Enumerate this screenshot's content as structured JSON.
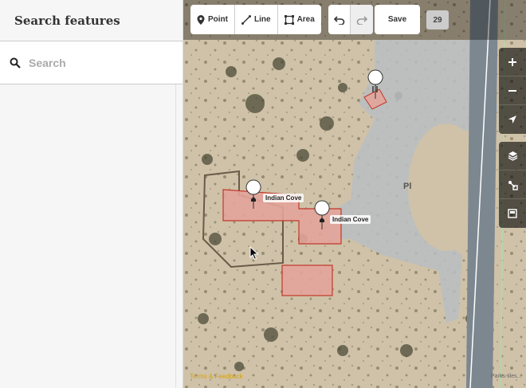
{
  "sidebar": {
    "title": "Search features",
    "search": {
      "placeholder": "Search",
      "value": ""
    }
  },
  "toolbar": {
    "point_label": "Point",
    "line_label": "Line",
    "area_label": "Area",
    "save_label": "Save",
    "edit_count": "29"
  },
  "map": {
    "pins": [
      {
        "label": "Indian Cove",
        "icon": "home-icon"
      },
      {
        "label": "Indian Cove",
        "icon": "home-icon"
      },
      {
        "label": "",
        "icon": "restaurant-icon"
      }
    ],
    "road_label": "Pl",
    "attribution_label": "Terms & Feedback",
    "imagery_credit": "Parks-tiles..."
  },
  "map_controls": [
    "zoom-in-icon",
    "zoom-out-icon",
    "geolocate-icon",
    "layers-icon",
    "map-data-icon",
    "issues-icon"
  ],
  "colors": {
    "building_fill": "#e3a49a",
    "building_stroke": "#c0392b",
    "road": "#b6bcc2",
    "toolbar_bg": "#ffffff"
  }
}
